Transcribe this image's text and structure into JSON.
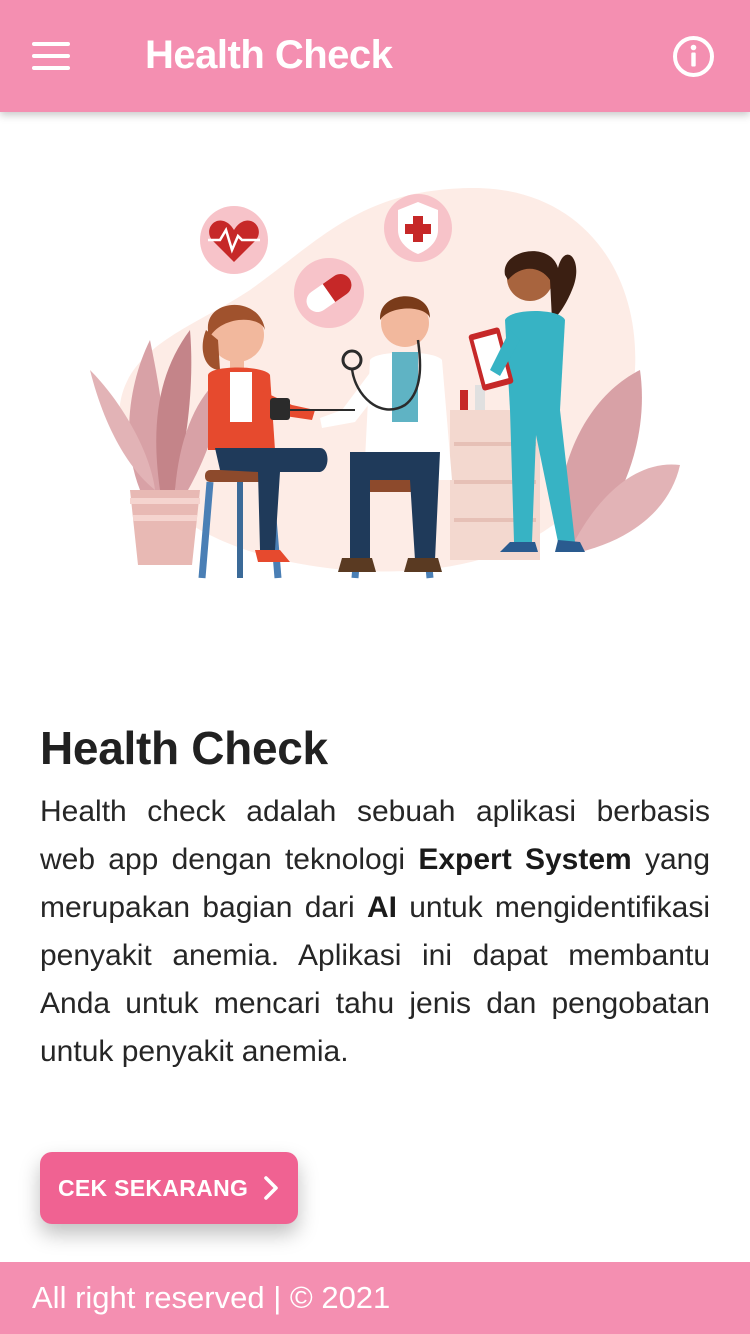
{
  "app_bar": {
    "title": "Health Check",
    "menu_icon": "hamburger-menu-icon",
    "info_icon": "info-circle-icon",
    "background": "#f48fb1"
  },
  "hero": {
    "illustration": "doctor-checkup-illustration"
  },
  "content": {
    "heading": "Health Check",
    "description": {
      "part1": "Health check adalah sebuah aplikasi berbasis web app dengan teknologi ",
      "bold1": "Expert System",
      "part2": " yang merupakan bagian dari ",
      "bold2": "AI",
      "part3": " untuk mengidentifikasi penyakit anemia. Aplikasi ini dapat membantu Anda untuk mencari tahu jenis dan pengobatan untuk penyakit anemia."
    }
  },
  "cta": {
    "label": "CEK SEKARANG",
    "icon": "chevron-right-icon",
    "color": "#f06292"
  },
  "footer": {
    "text": "All right reserved | © 2021"
  }
}
